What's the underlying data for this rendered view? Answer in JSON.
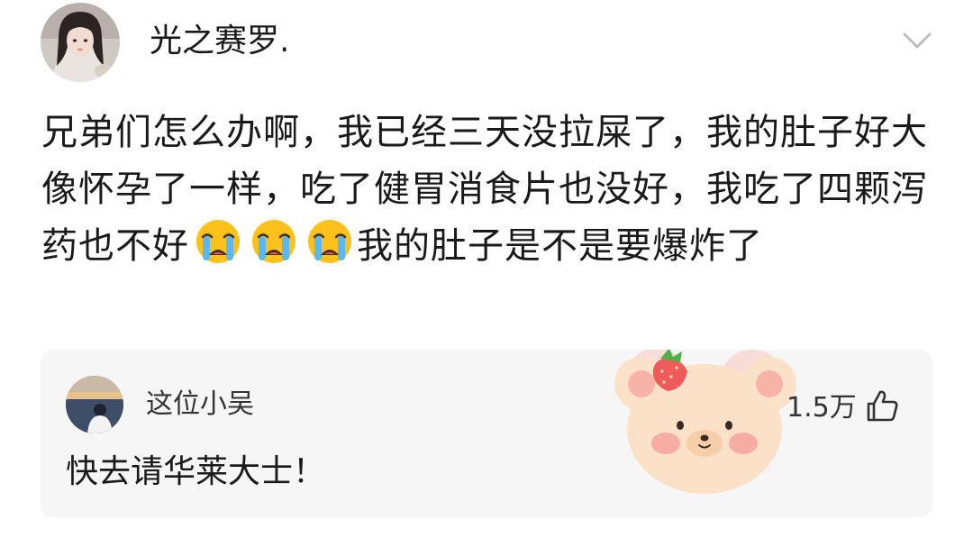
{
  "post": {
    "author": "光之赛罗.",
    "text_before_emoji": "兄弟们怎么办啊，我已经三天没拉屎了，我的肚子好大像怀孕了一样，吃了健胃消食片也没好，我吃了四颗泻药也不好",
    "emojis": [
      "loudly-crying-face",
      "loudly-crying-face",
      "loudly-crying-face"
    ],
    "text_after_emoji": "我的肚子是不是要爆炸了"
  },
  "comment": {
    "author": "这位小吴",
    "text": "快去请华莱大士！",
    "like_count": "1.5万",
    "sticker": "bear-with-strawberry"
  },
  "icons": {
    "chevron": "chevron-down-icon",
    "like": "thumbs-up-icon"
  },
  "colors": {
    "background": "#ffffff",
    "comment_card": "#f6f6f6",
    "text": "#1a1a1a",
    "secondary_text": "#333333",
    "chevron": "#bdbdbd"
  }
}
